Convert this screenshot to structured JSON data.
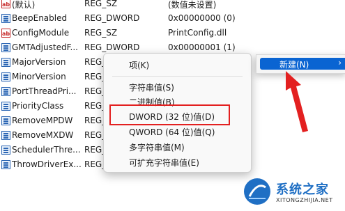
{
  "rows": [
    {
      "name": "(默认)",
      "type": "REG_SZ",
      "data": "(数值未设置)",
      "icon": "string-value-icon"
    },
    {
      "name": "BeepEnabled",
      "type": "REG_DWORD",
      "data": "0x00000000 (0)",
      "icon": "binary-value-icon"
    },
    {
      "name": "ConfigModule",
      "type": "REG_SZ",
      "data": "PrintConfig.dll",
      "icon": "string-value-icon"
    },
    {
      "name": "GMTAdjustedF...",
      "type": "REG_DWORD",
      "data": "0x00000001 (1)",
      "icon": "binary-value-icon"
    },
    {
      "name": "MajorVersion",
      "type": "REG_",
      "data": "",
      "icon": "binary-value-icon"
    },
    {
      "name": "MinorVersion",
      "type": "REG_",
      "data": "",
      "icon": "binary-value-icon"
    },
    {
      "name": "PortThreadPri...",
      "type": "REG_",
      "data": "",
      "icon": "binary-value-icon"
    },
    {
      "name": "PriorityClass",
      "type": "REG_",
      "data": "",
      "icon": "binary-value-icon"
    },
    {
      "name": "RemoveMPDW",
      "type": "REG_",
      "data": "",
      "icon": "binary-value-icon"
    },
    {
      "name": "RemoveMXDW",
      "type": "REG_",
      "data": "",
      "icon": "binary-value-icon"
    },
    {
      "name": "SchedulerThre...",
      "type": "REG_",
      "data": "",
      "icon": "binary-value-icon"
    },
    {
      "name": "ThrowDriverEx...",
      "type": "REG_",
      "data": "",
      "icon": "binary-value-icon"
    }
  ],
  "context_menu": {
    "key": "项(K)",
    "string": "字符串值(S)",
    "binary": "二进制值(B)",
    "dword": "DWORD (32 位)值(D)",
    "qword": "QWORD (64 位)值(Q)",
    "multi_string": "多字符串值(M)",
    "expandable_string": "可扩充字符串值(E)"
  },
  "submenu": {
    "new_label": "新建(N)",
    "chevron": "›"
  },
  "watermark": {
    "title": "系统之家",
    "url": "XITONGZHIJIA.NET"
  },
  "colors": {
    "highlight_box": "#e32020",
    "menu_selection": "#0a64d2",
    "watermark_blue": "#1f6fc4"
  }
}
